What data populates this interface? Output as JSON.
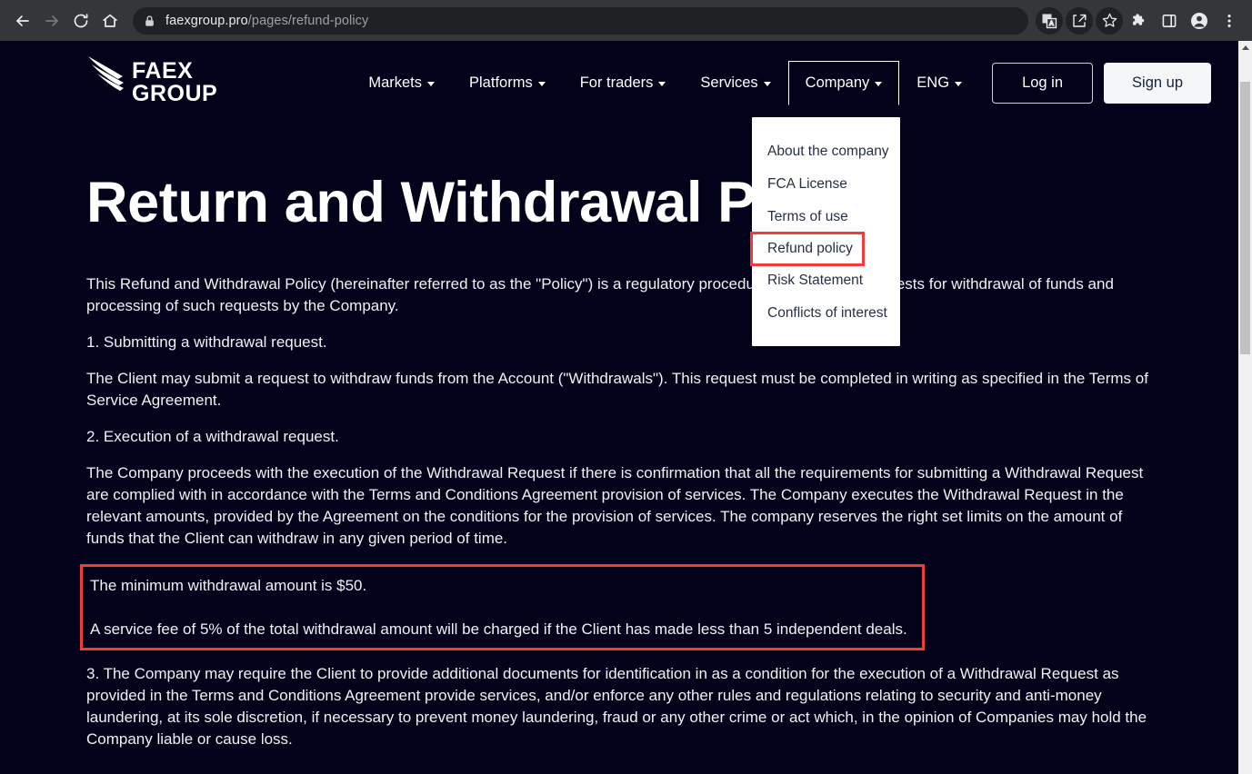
{
  "browser": {
    "back_label": "Back",
    "forward_label": "Forward",
    "reload_label": "Reload",
    "home_label": "Home",
    "url_host": "faexgroup.pro",
    "url_path": "/pages/refund-policy",
    "lock_icon": "lock-icon",
    "toolbar_icons": [
      "translate-icon",
      "share-icon",
      "bookmark-star-icon",
      "extensions-puzzle-icon",
      "side-panel-icon",
      "profile-avatar-icon",
      "three-dot-menu-icon"
    ]
  },
  "site": {
    "logo": {
      "icon": "faex-wing-icon",
      "line1": "FAEX",
      "line2": "GROUP"
    },
    "nav": [
      {
        "label": "Markets",
        "has_caret": true
      },
      {
        "label": "Platforms",
        "has_caret": true
      },
      {
        "label": "For traders",
        "has_caret": true
      },
      {
        "label": "Services",
        "has_caret": true
      },
      {
        "label": "Company",
        "has_caret": true
      },
      {
        "label": "ENG",
        "has_caret": true
      }
    ],
    "auth": {
      "login": "Log in",
      "signup": "Sign up"
    },
    "dropdown": {
      "open_for": "Company",
      "items": [
        {
          "label": "About the company",
          "highlighted": false
        },
        {
          "label": "FCA License",
          "highlighted": false
        },
        {
          "label": "Terms of use",
          "highlighted": false
        },
        {
          "label": "Refund policy",
          "highlighted": true
        },
        {
          "label": "Risk Statement",
          "highlighted": false
        },
        {
          "label": "Conflicts of interest",
          "highlighted": false
        }
      ]
    }
  },
  "main": {
    "title": "Return and Withdrawal Policy",
    "paragraphs": [
      "This Refund and Withdrawal Policy (hereinafter referred to as the \"Policy\") is a regulatory procedure for accepting requests for withdrawal of funds and processing of such requests by the Company.",
      "1. Submitting a withdrawal request.",
      "The Client may submit a request to withdraw funds from the Account (\"Withdrawals\"). This request must be completed in writing as specified in the Terms of Service Agreement.",
      "2. Execution of a withdrawal request.",
      "The Company proceeds with the execution of the Withdrawal Request if there is confirmation that all the requirements for submitting a Withdrawal Request are complied with in accordance with the Terms and Conditions Agreement provision of services. The Company executes the Withdrawal Request in the relevant amounts, provided by the Agreement on the conditions for the provision of services. The company reserves the right set limits on the amount of funds that the Client can withdraw in any given period of time."
    ],
    "highlighted": [
      "The minimum withdrawal amount is $50.",
      "A service fee of 5% of the total withdrawal amount will be charged if the Client has made less than 5 independent deals."
    ],
    "paragraphs_after": [
      "3. The Company may require the Client to provide additional documents for identification in as a condition for the execution of a Withdrawal Request as provided in the Terms and Conditions Agreement provide services, and/or enforce any other rules and regulations relating to security and anti-money laundering, at its sole discretion, if necessary to prevent money laundering, fraud or any other crime or act which, in the opinion of Companies may hold the Company liable or cause loss."
    ]
  },
  "colors": {
    "page_background": "#02021a",
    "text": "#f0f1f4",
    "highlight_red": "#f23b3b",
    "dropdown_background": "#ffffff",
    "dropdown_text": "#273043",
    "signup_background": "#f5f6f8",
    "browser_chrome": "#35363a"
  }
}
